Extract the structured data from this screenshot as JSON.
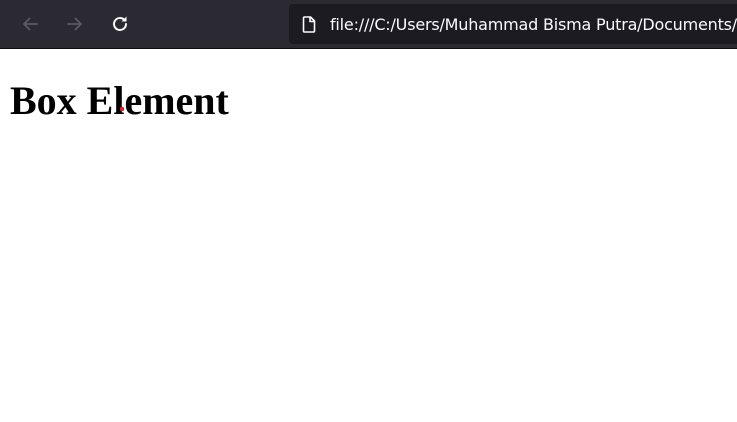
{
  "browser": {
    "url": "file:///C:/Users/Muhammad Bisma Putra/Documents/l",
    "icons": {
      "back": "arrow-left-icon",
      "forward": "arrow-right-icon",
      "reload": "reload-icon",
      "page": "page-icon"
    },
    "colors": {
      "toolbar": "#2b2a33",
      "urlbar": "#1c1b22",
      "text": "#fbfbfe"
    }
  },
  "page": {
    "heading": "Box Element"
  }
}
